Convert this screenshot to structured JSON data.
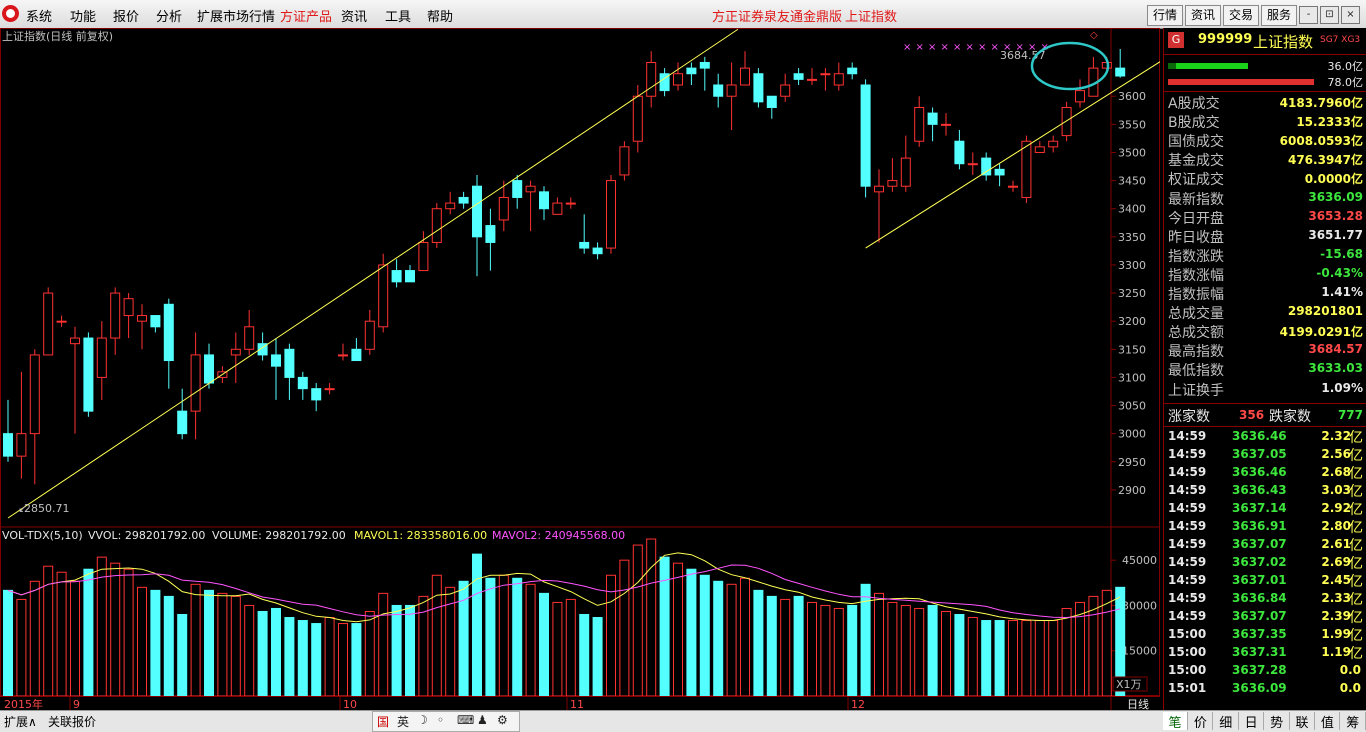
{
  "menu": {
    "items": [
      "系统",
      "功能",
      "报价",
      "分析",
      "扩展市场行情",
      "方证产品",
      "资讯",
      "工具",
      "帮助"
    ],
    "highlight_index": 5,
    "center_title": "方正证券泉友通金鼎版",
    "center_subtitle": "上证指数",
    "right_buttons": [
      "行情",
      "资讯",
      "交易",
      "服务"
    ],
    "window_buttons": [
      "-",
      "⊡",
      "×"
    ]
  },
  "chart": {
    "main_title": "上证指数(日线 前复权)",
    "high_label": "3684.57",
    "low_label": "2850.71",
    "price_ticks": [
      "3600",
      "3550",
      "3500",
      "3450",
      "3400",
      "3350",
      "3300",
      "3250",
      "3200",
      "3150",
      "3100",
      "3050",
      "3000",
      "2950",
      "2900"
    ],
    "vol_header": {
      "name": "VOL-TDX(5,10)",
      "vvol": "VVOL: 298201792.00",
      "volume": "VOLUME: 298201792.00",
      "mavol1": "MAVOL1: 283358016.00",
      "mavol2": "MAVOL2: 240945568.00"
    },
    "vol_ticks": [
      "45000",
      "30000",
      "15000"
    ],
    "vol_unit": "X1万",
    "date_labels": [
      "2015年",
      "9",
      "10",
      "11",
      "12"
    ],
    "period": "日线"
  },
  "chart_data": {
    "type": "candlestick",
    "title": "上证指数(日线 前复权)",
    "ylim": [
      2850,
      3700
    ],
    "candles": [
      [
        3000,
        2960,
        3060,
        2950
      ],
      [
        2960,
        3000,
        3110,
        2920
      ],
      [
        3000,
        3140,
        3150,
        2910
      ],
      [
        3140,
        3250,
        3260,
        3140
      ],
      [
        3200,
        3200,
        3210,
        3190
      ],
      [
        3160,
        3170,
        3190,
        3000
      ],
      [
        3170,
        3040,
        3180,
        3030
      ],
      [
        3100,
        3170,
        3200,
        3060
      ],
      [
        3170,
        3250,
        3260,
        3140
      ],
      [
        3210,
        3240,
        3250,
        3170
      ],
      [
        3200,
        3210,
        3230,
        3150
      ],
      [
        3210,
        3190,
        3200,
        3180
      ],
      [
        3230,
        3130,
        3240,
        3080
      ],
      [
        3040,
        3000,
        3080,
        2990
      ],
      [
        3040,
        3140,
        3180,
        2990
      ],
      [
        3140,
        3090,
        3160,
        3080
      ],
      [
        3100,
        3110,
        3120,
        3090
      ],
      [
        3140,
        3150,
        3180,
        3090
      ],
      [
        3150,
        3190,
        3220,
        3140
      ],
      [
        3160,
        3140,
        3180,
        3130
      ],
      [
        3140,
        3120,
        3170,
        3060
      ],
      [
        3150,
        3100,
        3160,
        3060
      ],
      [
        3100,
        3080,
        3110,
        3060
      ],
      [
        3080,
        3060,
        3090,
        3040
      ],
      [
        3080,
        3080,
        3090,
        3070
      ],
      [
        3140,
        3140,
        3160,
        3130
      ],
      [
        3150,
        3130,
        3170,
        3140
      ],
      [
        3150,
        3200,
        3220,
        3140
      ],
      [
        3190,
        3300,
        3320,
        3180
      ],
      [
        3290,
        3270,
        3310,
        3260
      ],
      [
        3290,
        3270,
        3300,
        3270
      ],
      [
        3290,
        3340,
        3360,
        3290
      ],
      [
        3340,
        3400,
        3410,
        3330
      ],
      [
        3400,
        3410,
        3430,
        3390
      ],
      [
        3420,
        3410,
        3430,
        3400
      ],
      [
        3440,
        3350,
        3460,
        3280
      ],
      [
        3370,
        3340,
        3400,
        3290
      ],
      [
        3380,
        3420,
        3450,
        3360
      ],
      [
        3450,
        3420,
        3460,
        3400
      ],
      [
        3430,
        3440,
        3450,
        3360
      ],
      [
        3430,
        3400,
        3440,
        3380
      ],
      [
        3390,
        3410,
        3420,
        3400
      ],
      [
        3410,
        3410,
        3420,
        3400
      ],
      [
        3340,
        3330,
        3390,
        3320
      ],
      [
        3330,
        3320,
        3340,
        3310
      ],
      [
        3330,
        3450,
        3460,
        3320
      ],
      [
        3460,
        3510,
        3520,
        3450
      ],
      [
        3520,
        3600,
        3620,
        3500
      ],
      [
        3600,
        3660,
        3680,
        3580
      ],
      [
        3640,
        3610,
        3650,
        3600
      ],
      [
        3620,
        3640,
        3660,
        3610
      ],
      [
        3650,
        3640,
        3660,
        3620
      ],
      [
        3660,
        3650,
        3670,
        3610
      ],
      [
        3620,
        3600,
        3640,
        3580
      ],
      [
        3600,
        3620,
        3660,
        3540
      ],
      [
        3620,
        3650,
        3680,
        3620
      ],
      [
        3640,
        3590,
        3650,
        3580
      ],
      [
        3600,
        3580,
        3600,
        3560
      ],
      [
        3600,
        3620,
        3640,
        3590
      ],
      [
        3640,
        3630,
        3650,
        3620
      ],
      [
        3630,
        3630,
        3650,
        3620
      ],
      [
        3640,
        3640,
        3650,
        3610
      ],
      [
        3620,
        3640,
        3660,
        3610
      ],
      [
        3650,
        3640,
        3660,
        3630
      ],
      [
        3620,
        3440,
        3630,
        3420
      ],
      [
        3430,
        3440,
        3470,
        3340
      ],
      [
        3440,
        3450,
        3490,
        3430
      ],
      [
        3440,
        3490,
        3530,
        3430
      ],
      [
        3520,
        3580,
        3600,
        3510
      ],
      [
        3570,
        3550,
        3580,
        3520
      ],
      [
        3550,
        3550,
        3570,
        3530
      ],
      [
        3520,
        3480,
        3540,
        3470
      ],
      [
        3480,
        3480,
        3500,
        3460
      ],
      [
        3490,
        3460,
        3500,
        3450
      ],
      [
        3470,
        3460,
        3480,
        3440
      ],
      [
        3440,
        3440,
        3450,
        3430
      ],
      [
        3420,
        3520,
        3530,
        3410
      ],
      [
        3500,
        3510,
        3520,
        3500
      ],
      [
        3510,
        3520,
        3530,
        3500
      ],
      [
        3530,
        3580,
        3590,
        3520
      ],
      [
        3590,
        3610,
        3630,
        3580
      ],
      [
        3600,
        3650,
        3670,
        3600
      ],
      [
        3650,
        3660,
        3670,
        3640
      ],
      [
        3650,
        3636,
        3684,
        3633
      ]
    ],
    "volumes": [
      35000,
      32000,
      38000,
      43000,
      41000,
      38000,
      42000,
      46000,
      44000,
      42000,
      36000,
      35000,
      33000,
      27000,
      37000,
      35000,
      34000,
      33000,
      30000,
      28000,
      29000,
      26000,
      25000,
      24000,
      26000,
      24000,
      24000,
      28000,
      34000,
      30000,
      30000,
      33000,
      40000,
      36000,
      38000,
      47000,
      39000,
      40000,
      39000,
      37000,
      34000,
      31000,
      32000,
      27000,
      26000,
      40000,
      45000,
      50000,
      52000,
      46000,
      44000,
      42000,
      40000,
      38000,
      37000,
      39000,
      35000,
      33000,
      32000,
      33000,
      31000,
      30000,
      29000,
      30000,
      37000,
      34000,
      31000,
      30000,
      29000,
      30000,
      28000,
      27000,
      26000,
      25000,
      25000,
      25000,
      25000,
      25000,
      25000,
      29000,
      31000,
      33000,
      35000,
      36000
    ],
    "vol_ylim": [
      0,
      54000
    ],
    "trendlines": [
      {
        "from": [
          0,
          2850
        ],
        "to": [
          50,
          3680
        ]
      },
      {
        "from": [
          64,
          3330
        ],
        "to": [
          84,
          3660
        ]
      }
    ]
  },
  "panel": {
    "code": "999999",
    "name": "上证指数",
    "flags": "SG7 XG3",
    "bar1_value": "36.0亿",
    "bar2_value": "78.0亿",
    "stats": [
      {
        "k": "A股成交",
        "v": "4183.7960亿",
        "c": "y"
      },
      {
        "k": "B股成交",
        "v": "15.2333亿",
        "c": "y"
      },
      {
        "k": "国债成交",
        "v": "6008.0593亿",
        "c": "y"
      },
      {
        "k": "基金成交",
        "v": "476.3947亿",
        "c": "y"
      },
      {
        "k": "权证成交",
        "v": "0.0000亿",
        "c": "y"
      },
      {
        "k": "最新指数",
        "v": "3636.09",
        "c": "g"
      },
      {
        "k": "今日开盘",
        "v": "3653.28",
        "c": "r"
      },
      {
        "k": "昨日收盘",
        "v": "3651.77",
        "c": "w"
      },
      {
        "k": "指数涨跌",
        "v": "-15.68",
        "c": "g"
      },
      {
        "k": "指数涨幅",
        "v": "-0.43%",
        "c": "g"
      },
      {
        "k": "指数振幅",
        "v": "1.41%",
        "c": "w"
      },
      {
        "k": "总成交量",
        "v": "298201801",
        "c": "y"
      },
      {
        "k": "总成交额",
        "v": "4199.0291亿",
        "c": "y"
      },
      {
        "k": "最高指数",
        "v": "3684.57",
        "c": "r"
      },
      {
        "k": "最低指数",
        "v": "3633.03",
        "c": "g"
      },
      {
        "k": "上证换手",
        "v": "1.09%",
        "c": "w"
      }
    ],
    "up_label": "涨家数",
    "up_count": "356",
    "down_label": "跌家数",
    "down_count": "777",
    "ticks": [
      {
        "t": "14:59",
        "p": "3636.46",
        "v": "2.32"
      },
      {
        "t": "14:59",
        "p": "3637.05",
        "v": "2.56"
      },
      {
        "t": "14:59",
        "p": "3636.46",
        "v": "2.68"
      },
      {
        "t": "14:59",
        "p": "3636.43",
        "v": "3.03"
      },
      {
        "t": "14:59",
        "p": "3637.14",
        "v": "2.92"
      },
      {
        "t": "14:59",
        "p": "3636.91",
        "v": "2.80"
      },
      {
        "t": "14:59",
        "p": "3637.07",
        "v": "2.61"
      },
      {
        "t": "14:59",
        "p": "3637.02",
        "v": "2.69"
      },
      {
        "t": "14:59",
        "p": "3637.01",
        "v": "2.45"
      },
      {
        "t": "14:59",
        "p": "3636.84",
        "v": "2.33"
      },
      {
        "t": "14:59",
        "p": "3637.07",
        "v": "2.39"
      },
      {
        "t": "15:00",
        "p": "3637.35",
        "v": "1.99"
      },
      {
        "t": "15:00",
        "p": "3637.31",
        "v": "1.19"
      },
      {
        "t": "15:00",
        "p": "3637.28",
        "v": "0.0"
      },
      {
        "t": "15:01",
        "p": "3636.09",
        "v": "0.0"
      }
    ],
    "yi_unit": "亿",
    "tabs": [
      "笔",
      "价",
      "细",
      "日",
      "势",
      "联",
      "值",
      "筹"
    ]
  },
  "bottom": {
    "tabs": [
      "扩展∧",
      "关联报价"
    ],
    "ime": [
      "国",
      "英",
      "☽",
      "◦",
      "⌨",
      "♟",
      "⚙"
    ]
  },
  "colors": {
    "up": "#ff3232",
    "down": "#54ffff",
    "ma1": "#ffff54",
    "ma2": "#ff54ff",
    "trend": "#ffff54",
    "grid": "#800000"
  }
}
